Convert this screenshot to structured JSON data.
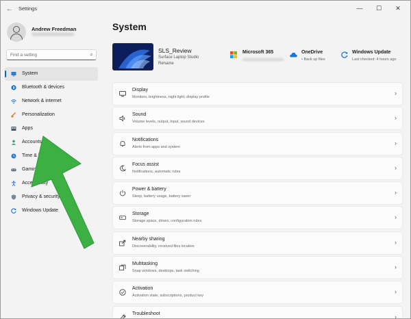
{
  "window": {
    "title": "Settings",
    "controls": {
      "minimize": "—",
      "maximize": "☐",
      "close": "✕"
    }
  },
  "user": {
    "name": "Andrew Freedman"
  },
  "search": {
    "placeholder": "Find a setting"
  },
  "sidebar": {
    "items": [
      {
        "label": "System",
        "icon": "system-icon",
        "active": true
      },
      {
        "label": "Bluetooth & devices",
        "icon": "bluetooth-icon"
      },
      {
        "label": "Network & internet",
        "icon": "network-icon"
      },
      {
        "label": "Personalization",
        "icon": "brush-icon"
      },
      {
        "label": "Apps",
        "icon": "apps-icon"
      },
      {
        "label": "Accounts",
        "icon": "accounts-icon"
      },
      {
        "label": "Time & language",
        "icon": "time-language-icon"
      },
      {
        "label": "Gaming",
        "icon": "gaming-icon"
      },
      {
        "label": "Accessibility",
        "icon": "accessibility-icon"
      },
      {
        "label": "Privacy & security",
        "icon": "shield-icon"
      },
      {
        "label": "Windows Update",
        "icon": "windows-update-icon"
      }
    ]
  },
  "main": {
    "title": "System",
    "device": {
      "name": "SLS_Review",
      "model": "Surface Laptop Studio",
      "rename": "Rename"
    },
    "quick_links": [
      {
        "title": "Microsoft 365",
        "subtitle": "",
        "icon": "microsoft-365-icon"
      },
      {
        "title": "OneDrive",
        "subtitle": "• Back up files",
        "icon": "onedrive-icon"
      },
      {
        "title": "Windows Update",
        "subtitle": "Last checked: 4 hours ago",
        "icon": "windows-update-icon"
      }
    ],
    "settings": [
      {
        "title": "Display",
        "subtitle": "Monitors, brightness, night light, display profile",
        "icon": "display-icon"
      },
      {
        "title": "Sound",
        "subtitle": "Volume levels, output, input, sound devices",
        "icon": "sound-icon"
      },
      {
        "title": "Notifications",
        "subtitle": "Alerts from apps and system",
        "icon": "bell-icon"
      },
      {
        "title": "Focus assist",
        "subtitle": "Notifications, automatic rules",
        "icon": "moon-icon"
      },
      {
        "title": "Power & battery",
        "subtitle": "Sleep, battery usage, battery saver",
        "icon": "power-icon"
      },
      {
        "title": "Storage",
        "subtitle": "Storage space, drives, configuration rules",
        "icon": "storage-icon"
      },
      {
        "title": "Nearby sharing",
        "subtitle": "Discoverability, received files location",
        "icon": "share-icon"
      },
      {
        "title": "Multitasking",
        "subtitle": "Snap windows, desktops, task switching",
        "icon": "multitasking-icon"
      },
      {
        "title": "Activation",
        "subtitle": "Activation state, subscriptions, product key",
        "icon": "activation-icon"
      },
      {
        "title": "Troubleshoot",
        "subtitle": "",
        "icon": "troubleshoot-icon"
      }
    ]
  },
  "colors": {
    "accent": "#0067c0",
    "annotation_arrow": "#3cb043"
  }
}
